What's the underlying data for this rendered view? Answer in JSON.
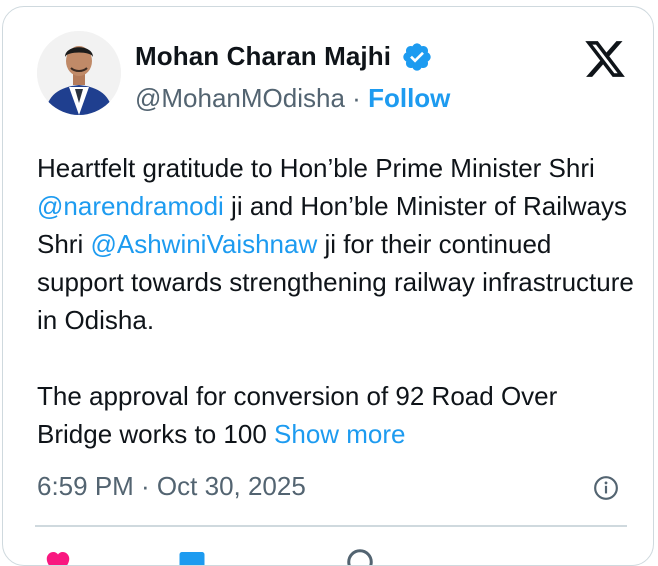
{
  "author": {
    "name": "Mohan Charan Majhi",
    "handle": "@MohanMOdisha",
    "separator": "·",
    "follow_label": "Follow",
    "verified": true
  },
  "tweet": {
    "para1_a": "Heartfelt gratitude to Hon’ble Prime Minister Shri ",
    "mention1": "@narendramodi",
    "para1_b": " ji and Hon’ble Minister of Railways Shri ",
    "mention2": "@AshwiniVaishnaw",
    "para1_c": " ji for their continued support towards strengthening railway infrastructure in Odisha.",
    "para2": "The approval for conversion of 92 Road Over Bridge works to 100 ",
    "show_more": "Show more"
  },
  "meta": {
    "timestamp": "6:59 PM · Oct 30, 2025"
  },
  "icons": {
    "verified": "verified-badge-icon",
    "platform": "x-logo-icon",
    "info": "info-icon",
    "like": "heart-icon",
    "reply": "reply-icon",
    "copy": "link-icon"
  },
  "colors": {
    "link": "#1d9bf0",
    "text": "#0f1419",
    "muted": "#536471",
    "border": "#cfd9de",
    "like": "#f91880"
  }
}
